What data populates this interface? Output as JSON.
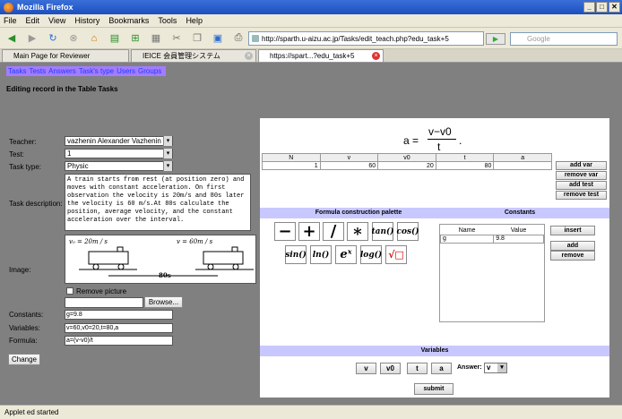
{
  "window": {
    "title": "Mozilla Firefox"
  },
  "menu": [
    "File",
    "Edit",
    "View",
    "History",
    "Bookmarks",
    "Tools",
    "Help"
  ],
  "toolbar": {
    "url": "http://sparth.u-aizu.ac.jp/Tasks/edit_teach.php?edu_task+5",
    "search_placeholder": "Google"
  },
  "tabs": [
    {
      "label": "Main Page for Reviewer"
    },
    {
      "label": "IEICE 会員管理システム"
    },
    {
      "label": "https://spart...?edu_task+5"
    }
  ],
  "nav": [
    "Tasks",
    "Tests",
    "Answers",
    "Task's type",
    "Users",
    "Groups"
  ],
  "page": {
    "heading": "Editing record in the Table Tasks",
    "teacher_label": "Teacher:",
    "teacher_value": "vazhenin Alexander Vazhenin",
    "test_label": "Test:",
    "test_value": "1",
    "task_type_label": "Task type:",
    "task_type_value": "Physic",
    "task_description_label": "Task description:",
    "task_description": "A train starts from rest (at position zero) and moves with constant acceleration. On first observation the velocity is 20m/s and 80s later the velocity is 60 m/s.At 80s calculate the position, average velocity, and the constant acceleration over the interval.",
    "image_label": "Image:",
    "remove_picture_label": "Remove picture",
    "browse_label": "Browse...",
    "constants_label": "Constants:",
    "constants_value": "g=9.8",
    "variables_label": "Variables:",
    "variables_value": "v=60,v0=20,t=80,a",
    "formula_label": "Formula:",
    "formula_value": "a=(v-v0)/t",
    "change_label": "Change"
  },
  "picture": {
    "v0": "v₀ = 20m / s",
    "v": "v = 60m / s",
    "dist": "80s"
  },
  "applet": {
    "formula_lhs": "a =",
    "formula_num": "v−v0",
    "formula_den": "t",
    "formula_end": ".",
    "table_headers": [
      "N",
      "v",
      "v0",
      "t",
      "a"
    ],
    "table_row": [
      "1",
      "60",
      "20",
      "80",
      ""
    ],
    "side_buttons": [
      "add var",
      "remove var",
      "add test",
      "remove test"
    ],
    "palette_title": "Formula construction palette",
    "constants_title": "Constants",
    "palette_row1": [
      "−",
      "+",
      "/",
      "∗",
      "tan()",
      "cos()"
    ],
    "palette_row2": [
      "sin()",
      "ln()",
      "eˣ",
      "log()",
      "√□"
    ],
    "const_headers": [
      "Name",
      "Value"
    ],
    "const_row": [
      "g",
      "9.8"
    ],
    "insert_label": "insert",
    "add_label": "add",
    "remove_label": "remove",
    "variables_title": "Variables",
    "var_buttons": [
      "v",
      "v0",
      "t",
      "a"
    ],
    "answer_label": "Answer:",
    "answer_value": "v",
    "submit_label": "submit"
  },
  "status": "Applet ed started"
}
